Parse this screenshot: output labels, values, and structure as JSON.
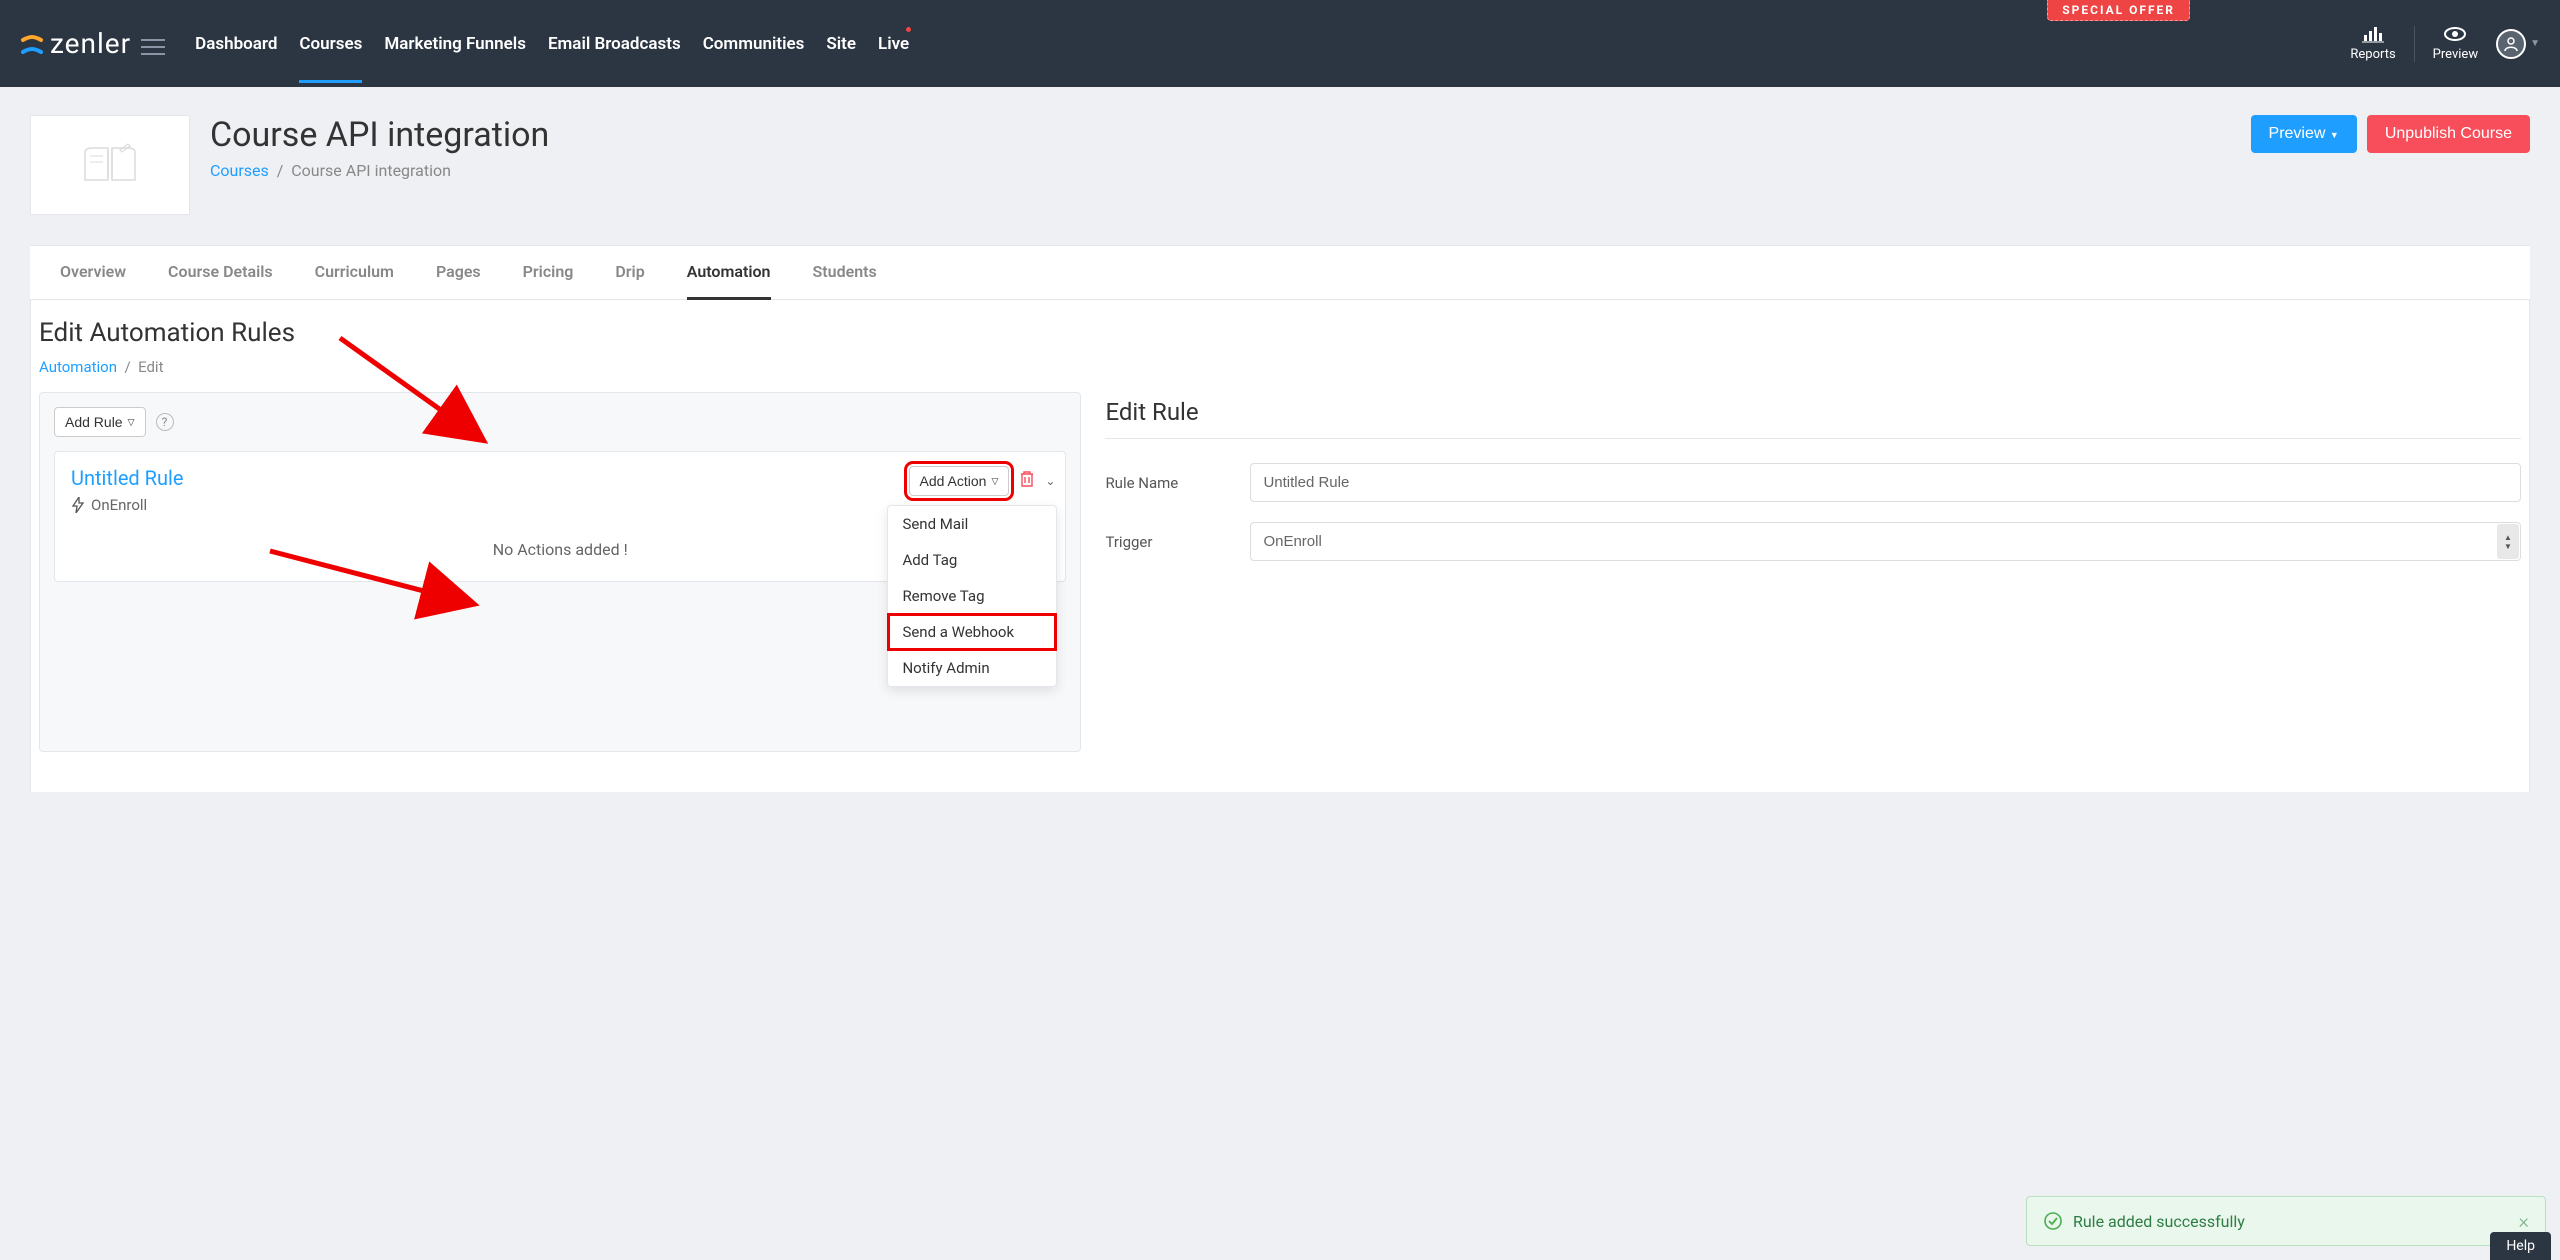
{
  "special_offer": "SPECIAL OFFER",
  "logo_text": "zenler",
  "nav": {
    "dashboard": "Dashboard",
    "courses": "Courses",
    "marketing_funnels": "Marketing Funnels",
    "email_broadcasts": "Email Broadcasts",
    "communities": "Communities",
    "site": "Site",
    "live": "Live",
    "reports": "Reports",
    "preview": "Preview"
  },
  "page": {
    "title": "Course API integration",
    "breadcrumb_root": "Courses",
    "breadcrumb_current": "Course API integration",
    "preview_btn": "Preview",
    "unpublish_btn": "Unpublish Course"
  },
  "tabs": {
    "overview": "Overview",
    "course_details": "Course Details",
    "curriculum": "Curriculum",
    "pages": "Pages",
    "pricing": "Pricing",
    "drip": "Drip",
    "automation": "Automation",
    "students": "Students"
  },
  "automation": {
    "title": "Edit Automation Rules",
    "breadcrumb_root": "Automation",
    "breadcrumb_current": "Edit",
    "add_rule_btn": "Add Rule",
    "rule": {
      "title": "Untitled Rule",
      "trigger_label": "OnEnroll",
      "add_action_btn": "Add Action",
      "no_actions": "No Actions added !"
    },
    "dropdown": {
      "send_mail": "Send Mail",
      "add_tag": "Add Tag",
      "remove_tag": "Remove Tag",
      "send_webhook": "Send a Webhook",
      "notify_admin": "Notify Admin"
    }
  },
  "edit_rule": {
    "title": "Edit Rule",
    "rule_name_label": "Rule Name",
    "rule_name_value": "Untitled Rule",
    "trigger_label": "Trigger",
    "trigger_value": "OnEnroll"
  },
  "toast": {
    "message": "Rule added successfully"
  },
  "help_btn": "Help"
}
